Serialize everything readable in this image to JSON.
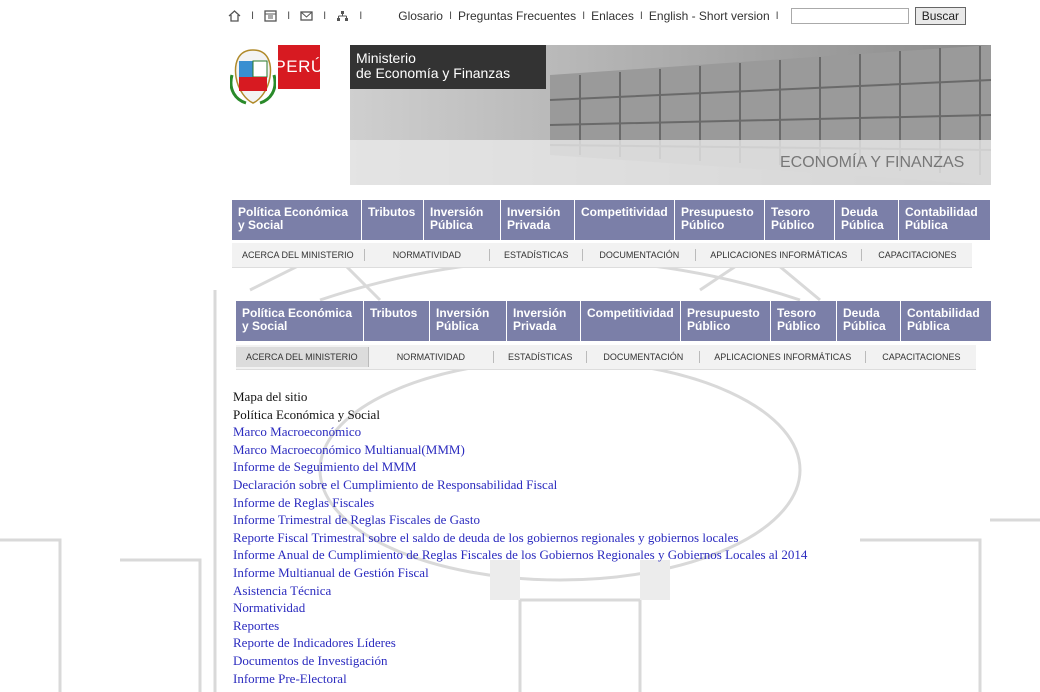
{
  "top_icons": [
    "home-icon",
    "calendar-icon",
    "mail-icon",
    "sitemap-icon"
  ],
  "top_links": [
    "Glosario",
    "Preguntas Frecuentes",
    "Enlaces",
    "English - Short version"
  ],
  "search": {
    "placeholder": "",
    "button": "Buscar"
  },
  "header": {
    "peru": "PERÚ",
    "ministry_line1": "Ministerio",
    "ministry_line2": "de Economía y Finanzas"
  },
  "nav": [
    "Política Económica y Social",
    "Tributos",
    "Inversión Pública",
    "Inversión Privada",
    "Competitividad",
    "Presupuesto Público",
    "Tesoro Público",
    "Deuda Pública",
    "Contabilidad Pública"
  ],
  "subnav": [
    "ACERCA DEL MINISTERIO",
    "NORMATIVIDAD",
    "ESTADÍSTICAS",
    "DOCUMENTACIÓN",
    "APLICACIONES INFORMÁTICAS",
    "CAPACITACIONES"
  ],
  "sitemap": {
    "title": "Mapa del sitio",
    "section": "Política Económica y Social",
    "links": [
      "Marco Macroeconómico",
      "Marco Macroeconómico Multianual(MMM)",
      "Informe de Seguimiento del MMM",
      "Declaración sobre el Cumplimiento de Responsabilidad Fiscal",
      "Informe de Reglas Fiscales",
      "Informe Trimestral de Reglas Fiscales de Gasto",
      "Reporte Fiscal Trimestral sobre el saldo de deuda de los gobiernos regionales y gobiernos locales",
      "Informe Anual de Cumplimiento de Reglas Fiscales de los Gobiernos Regionales y Gobiernos Locales al 2014",
      "Informe Multianual de Gestión Fiscal",
      "Asistencia Técnica",
      "Normatividad",
      "Reportes",
      "Reporte de Indicadores Líderes",
      "Documentos de Investigación",
      "Informe Pre-Electoral"
    ]
  },
  "colors": {
    "nav_bg": "#7b7fa8",
    "peru_red": "#d71a21",
    "link_blue": "#2b2bbf"
  }
}
